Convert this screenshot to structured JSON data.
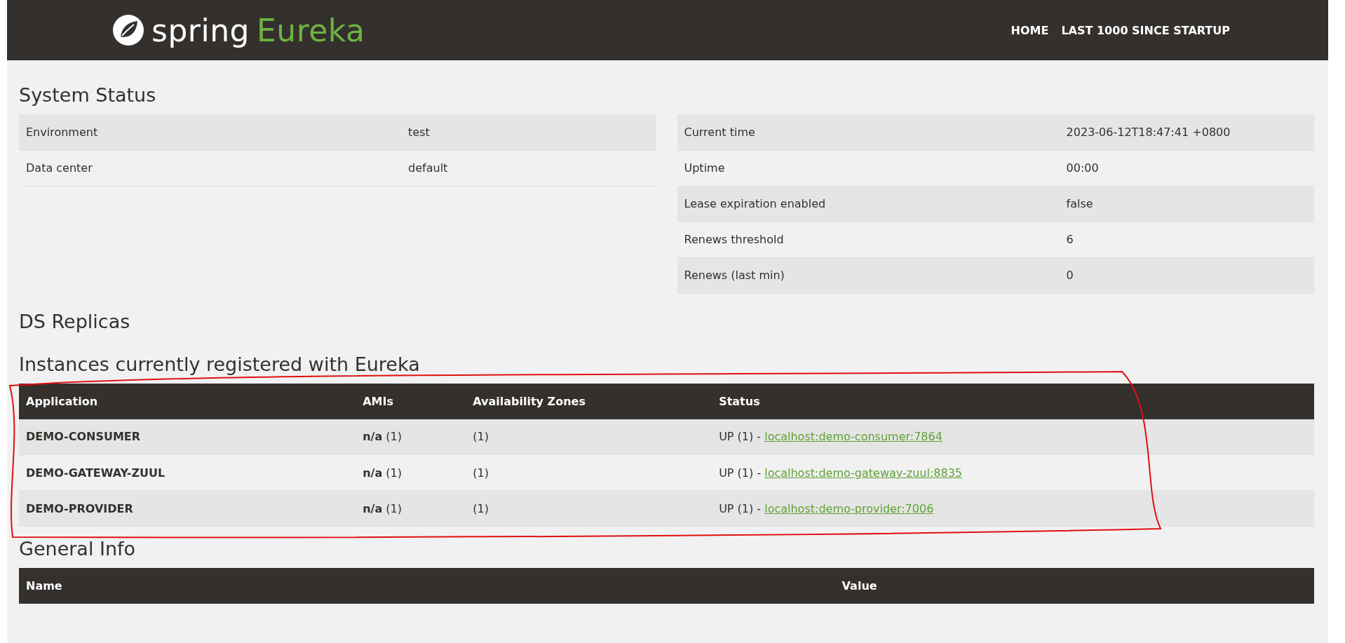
{
  "brand": {
    "word": "spring",
    "product": "Eureka"
  },
  "nav": [
    "HOME",
    "LAST 1000 SINCE STARTUP"
  ],
  "system_status": {
    "title": "System Status",
    "left": [
      {
        "label": "Environment",
        "value": "test"
      },
      {
        "label": "Data center",
        "value": "default"
      }
    ],
    "right": [
      {
        "label": "Current time",
        "value": "2023-06-12T18:47:41 +0800"
      },
      {
        "label": "Uptime",
        "value": "00:00"
      },
      {
        "label": "Lease expiration enabled",
        "value": "false"
      },
      {
        "label": "Renews threshold",
        "value": "6"
      },
      {
        "label": "Renews (last min)",
        "value": "0"
      }
    ]
  },
  "ds_replicas": {
    "title": "DS Replicas"
  },
  "instances": {
    "title": "Instances currently registered with Eureka",
    "columns": [
      "Application",
      "AMIs",
      "Availability Zones",
      "Status"
    ],
    "rows": [
      {
        "application": "DEMO-CONSUMER",
        "amis": "**n/a** (1)",
        "zones": "(1)",
        "status": "UP (1) - ",
        "link": "localhost:demo-consumer:7864"
      },
      {
        "application": "DEMO-GATEWAY-ZUUL",
        "amis": "**n/a** (1)",
        "zones": "(1)",
        "status": "UP (1) - ",
        "link": "localhost:demo-gateway-zuul:8835"
      },
      {
        "application": "DEMO-PROVIDER",
        "amis": "**n/a** (1)",
        "zones": "(1)",
        "status": "UP (1) - ",
        "link": "localhost:demo-provider:7006"
      }
    ]
  },
  "general_info": {
    "title": "General Info",
    "columns": [
      "Name",
      "Value"
    ]
  }
}
